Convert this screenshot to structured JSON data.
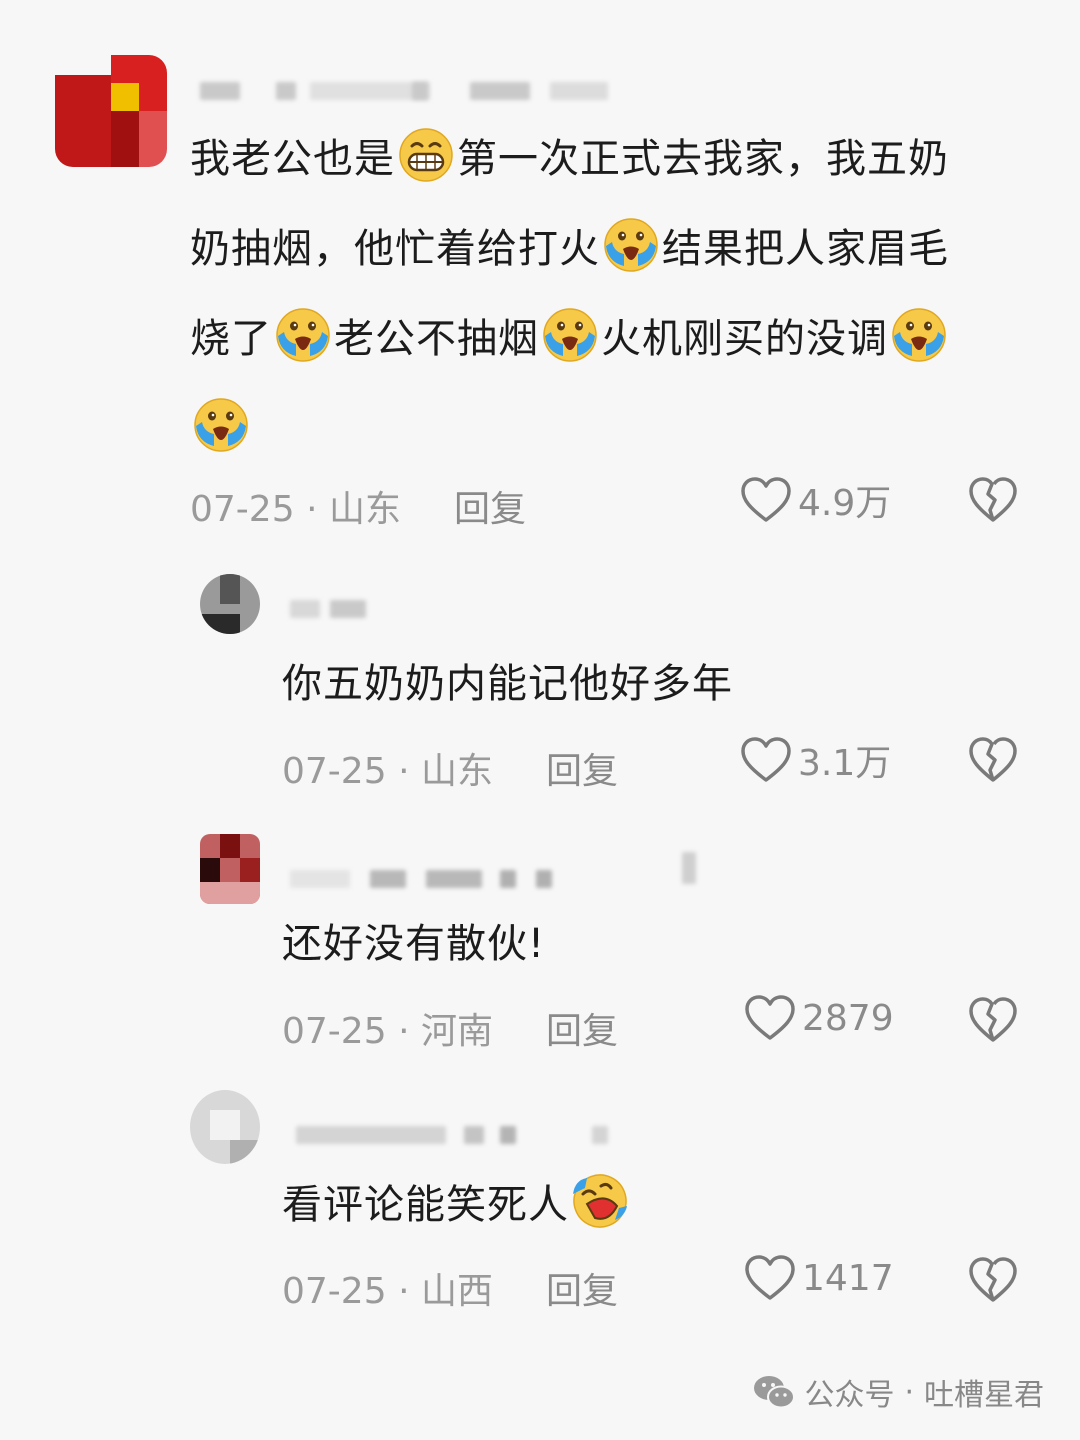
{
  "comments": [
    {
      "avatar_colors": [
        "#c01818",
        "#e8a400",
        "#d02020",
        "#7a0a0a",
        "#f0c000"
      ],
      "text_lines": [
        [
          {
            "t": "我老公也是"
          },
          {
            "emoji": "grin-emoji"
          },
          {
            "t": "第一次正式去我家，我五奶"
          }
        ],
        [
          {
            "t": "奶抽烟，他忙着给打火"
          },
          {
            "emoji": "cry-emoji"
          },
          {
            "t": "结果把人家眉毛"
          }
        ],
        [
          {
            "t": "烧了"
          },
          {
            "emoji": "cry-emoji"
          },
          {
            "t": "老公不抽烟"
          },
          {
            "emoji": "cry-emoji"
          },
          {
            "t": "火机刚买的没调"
          },
          {
            "emoji": "cry-emoji"
          }
        ],
        [
          {
            "emoji": "cry-emoji"
          }
        ]
      ],
      "date": "07-25",
      "location": "山东",
      "reply_label": "回复",
      "likes": "4.9万"
    },
    {
      "avatar_colors": [
        "#555555",
        "#888888",
        "#333333",
        "#aaaaaa"
      ],
      "text_lines": [
        [
          {
            "t": "你五奶奶内能记他好多年"
          }
        ]
      ],
      "date": "07-25",
      "location": "山东",
      "reply_label": "回复",
      "likes": "3.1万"
    },
    {
      "avatar_colors": [
        "#7a1010",
        "#c04040",
        "#2a0a0a",
        "#d88080"
      ],
      "text_lines": [
        [
          {
            "t": "还好没有散伙!"
          }
        ]
      ],
      "date": "07-25",
      "location": "河南",
      "reply_label": "回复",
      "likes": "2879"
    },
    {
      "avatar_colors": [
        "#d0d0d0",
        "#e8e8e8",
        "#b0b0b0",
        "#f0f0f0"
      ],
      "text_lines": [
        [
          {
            "t": "看评论能笑死人"
          },
          {
            "emoji": "laugh-emoji"
          }
        ]
      ],
      "date": "07-25",
      "location": "山西",
      "reply_label": "回复",
      "likes": "1417"
    }
  ],
  "watermark": {
    "source": "公众号",
    "separator": "·",
    "author": "吐槽星君"
  }
}
